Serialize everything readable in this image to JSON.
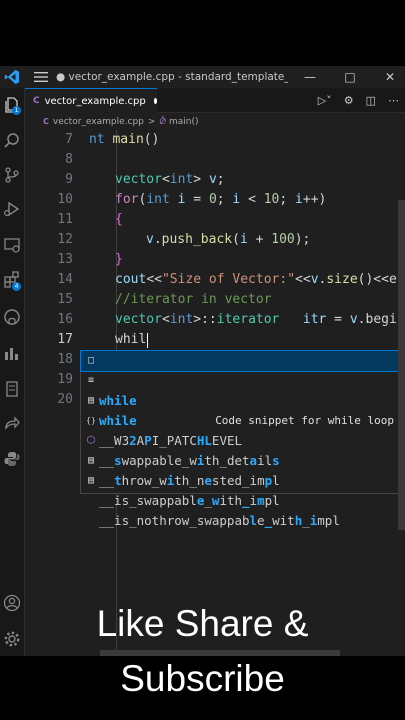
{
  "titlebar": {
    "title": "● vector_example.cpp - standard_template_libra...",
    "minimize_icon": "minimize-icon",
    "maximize_icon": "maximize-icon",
    "close_icon": "close-icon"
  },
  "activity_bar": {
    "icons": [
      "files-icon",
      "search-icon",
      "source-control-icon",
      "run-debug-icon",
      "remote-explorer-icon",
      "extensions-icon",
      "github-icon",
      "testing-icon",
      "notebook-icon",
      "share-icon",
      "python-icon",
      "account-icon",
      "settings-gear-icon"
    ],
    "badges": [
      "1",
      "4"
    ]
  },
  "tab": {
    "label": "vector_example.cpp",
    "icon": "C",
    "dirty": true
  },
  "breadcrumb": {
    "file": "vector_example.cpp",
    "sep": ">",
    "symbol": "main()"
  },
  "editor": {
    "lines": [
      {
        "n": "7"
      },
      {
        "n": "8"
      },
      {
        "n": "9"
      },
      {
        "n": "10"
      },
      {
        "n": "11"
      },
      {
        "n": "12"
      },
      {
        "n": "13"
      },
      {
        "n": "14"
      },
      {
        "n": "15"
      },
      {
        "n": "16"
      },
      {
        "n": "17"
      },
      {
        "n": "18"
      },
      {
        "n": "19"
      },
      {
        "n": "20"
      }
    ],
    "code": {
      "l7_kw": "nt",
      "l7_fn": " main",
      "l7_rest": "()",
      "l9_ty": "vector",
      "l9_a": "<",
      "l9_kw": "int",
      "l9_b": "> ",
      "l9_var": "v",
      "l9_c": ";",
      "l10_ctl": "for",
      "l10_a": "(",
      "l10_kw": "int",
      "l10_var": " i",
      "l10_b": " = ",
      "l10_n1": "0",
      "l10_c": "; ",
      "l10_var2": "i",
      "l10_d": " < ",
      "l10_n2": "10",
      "l10_e": "; ",
      "l10_var3": "i",
      "l10_f": "++)",
      "l11": "{",
      "l12_var": "v",
      "l12_a": ".",
      "l12_fn": "push_back",
      "l12_b": "(",
      "l12_var2": "i",
      "l12_c": " + ",
      "l12_num": "100",
      "l12_d": ");",
      "l13": "}",
      "l14_var": "cout",
      "l14_a": "<<",
      "l14_str": "\"Size of Vector:\"",
      "l14_b": "<<",
      "l14_var2": "v",
      "l14_c": ".",
      "l14_fn": "size",
      "l14_d": "()<<e",
      "l15": "//iterator in vector",
      "l16_ty": "vector",
      "l16_a": "<",
      "l16_kw": "int",
      "l16_b": ">::",
      "l16_ty2": "iterator",
      "l16_var": "   itr",
      "l16_c": " = ",
      "l16_var2": "v",
      "l16_d": ".begi",
      "l17": "whil"
    }
  },
  "suggest": {
    "items": [
      {
        "icon": "snippet-icon",
        "match": "while",
        "rest": "",
        "detail": "Code snippet for while loop"
      },
      {
        "icon": "keyword-icon",
        "match": "while",
        "rest": "",
        "detail": ""
      },
      {
        "icon": "constant-icon",
        "label": "__W32API_PATCHLEVEL"
      },
      {
        "icon": "namespace-icon",
        "label": "__swappable_with_details"
      },
      {
        "icon": "class-icon",
        "label": "__throw_with_nested_impl"
      },
      {
        "icon": "struct-icon",
        "label": "__is_swappable_with_impl"
      },
      {
        "icon": "struct-icon",
        "label": "__is_nothrow_swappable_with_impl"
      }
    ]
  },
  "overlay": {
    "line1": "Like Share &",
    "line2": "Subscribe"
  }
}
